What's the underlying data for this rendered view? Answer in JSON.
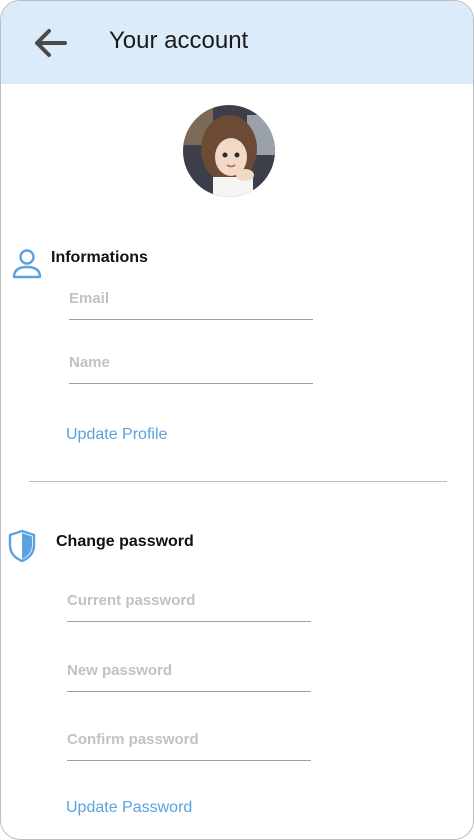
{
  "header": {
    "title": "Your account",
    "back_icon": "arrow-left-icon",
    "background": "#dcebf9"
  },
  "profile": {
    "avatar": "avatar-photo"
  },
  "informations": {
    "title": "Informations",
    "icon": "user-icon",
    "fields": [
      {
        "placeholder": "Email",
        "value": ""
      },
      {
        "placeholder": "Name",
        "value": ""
      }
    ],
    "action_label": "Update Profile"
  },
  "password": {
    "title": "Change password",
    "icon": "shield-icon",
    "fields": [
      {
        "placeholder": "Current password",
        "value": ""
      },
      {
        "placeholder": "New password",
        "value": ""
      },
      {
        "placeholder": "Confirm password",
        "value": ""
      }
    ],
    "action_label": "Update Password"
  },
  "colors": {
    "accent": "#5aa2e0",
    "placeholder": "#c2c2c2"
  }
}
